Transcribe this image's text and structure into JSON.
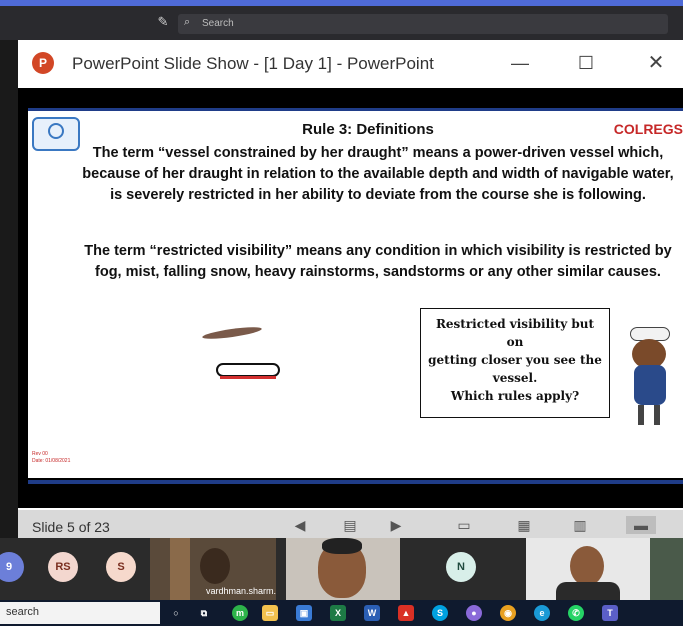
{
  "meeting": {
    "search_placeholder": "Search"
  },
  "window": {
    "title": "PowerPoint Slide Show - [1 Day 1] - PowerPoint",
    "minimize": "—",
    "maximize": "☐",
    "close": "✕"
  },
  "slide": {
    "title": "Rule 3: Definitions",
    "tag": "COLREGS",
    "paragraph_1": "The term “vessel constrained by her draught” means a power-driven vessel which, because of her draught in relation to the available depth and width of navigable water, is severely restricted in her ability to deviate from the course she is following.",
    "paragraph_2": "The term “restricted visibility” means any condition in which visibility is restricted by fog, mist, falling snow, heavy rainstorms, sandstorms or any other similar causes.",
    "bubble_lines": [
      "Restricted visibility but",
      "on",
      "getting closer you see the",
      "vessel.",
      "Which rules apply?"
    ],
    "footer_small": [
      "Rev 00",
      "Date: 01/08/2021"
    ]
  },
  "statusbar": {
    "slide_count": "Slide 5 of 23"
  },
  "participants": [
    {
      "initials": "9",
      "color": "#6c7fd9"
    },
    {
      "initials": "RS",
      "color": "#f3d7cf"
    },
    {
      "initials": "S",
      "color": "#f6d9cc"
    },
    {
      "name": "vardhman.sharm..."
    },
    {},
    {
      "initials": "N",
      "color": "#d8efe9"
    },
    {}
  ],
  "taskbar": {
    "search_text": "search"
  },
  "colors": {
    "accent_blue": "#1f3c88",
    "colregs_red": "#c62828",
    "ppt_orange": "#d24726"
  }
}
